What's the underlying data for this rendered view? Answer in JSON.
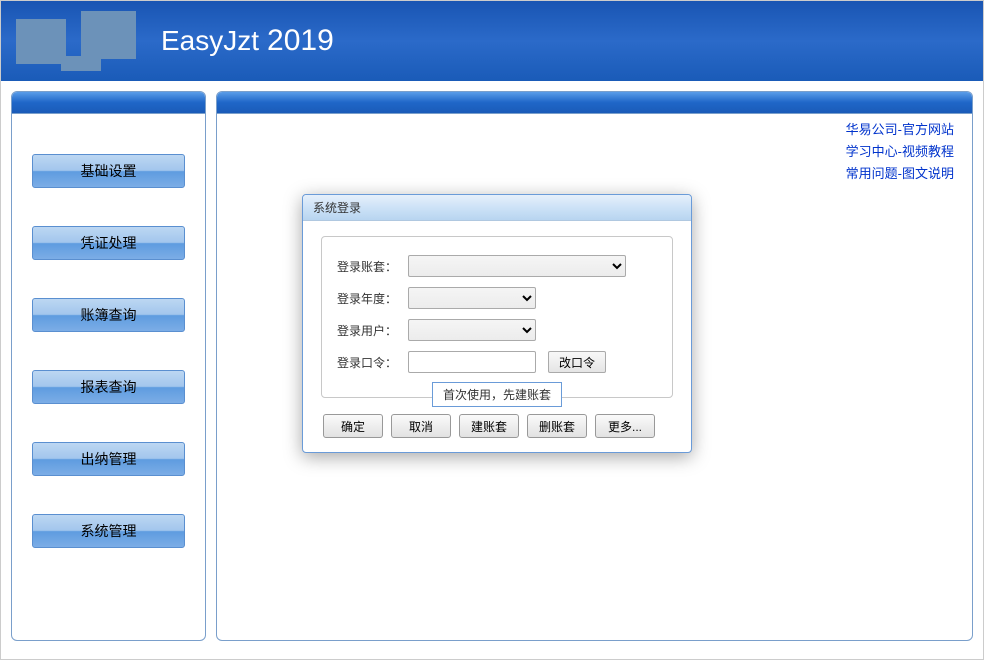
{
  "header": {
    "app_name": "EasyJzt",
    "app_year": "2019"
  },
  "sidebar": {
    "items": [
      {
        "label": "基础设置"
      },
      {
        "label": "凭证处理"
      },
      {
        "label": "账簿查询"
      },
      {
        "label": "报表查询"
      },
      {
        "label": "出纳管理"
      },
      {
        "label": "系统管理"
      }
    ]
  },
  "links": {
    "official": "华易公司-官方网站",
    "tutorial": "学习中心-视频教程",
    "faq": "常用问题-图文说明"
  },
  "dialog": {
    "title": "系统登录",
    "labels": {
      "account": "登录账套：",
      "year": "登录年度：",
      "user": "登录用户：",
      "password": "登录口令："
    },
    "change_password": "改口令",
    "hint": "首次使用，先建账套",
    "buttons": {
      "ok": "确定",
      "cancel": "取消",
      "create": "建账套",
      "delete": "删账套",
      "more": "更多..."
    }
  }
}
